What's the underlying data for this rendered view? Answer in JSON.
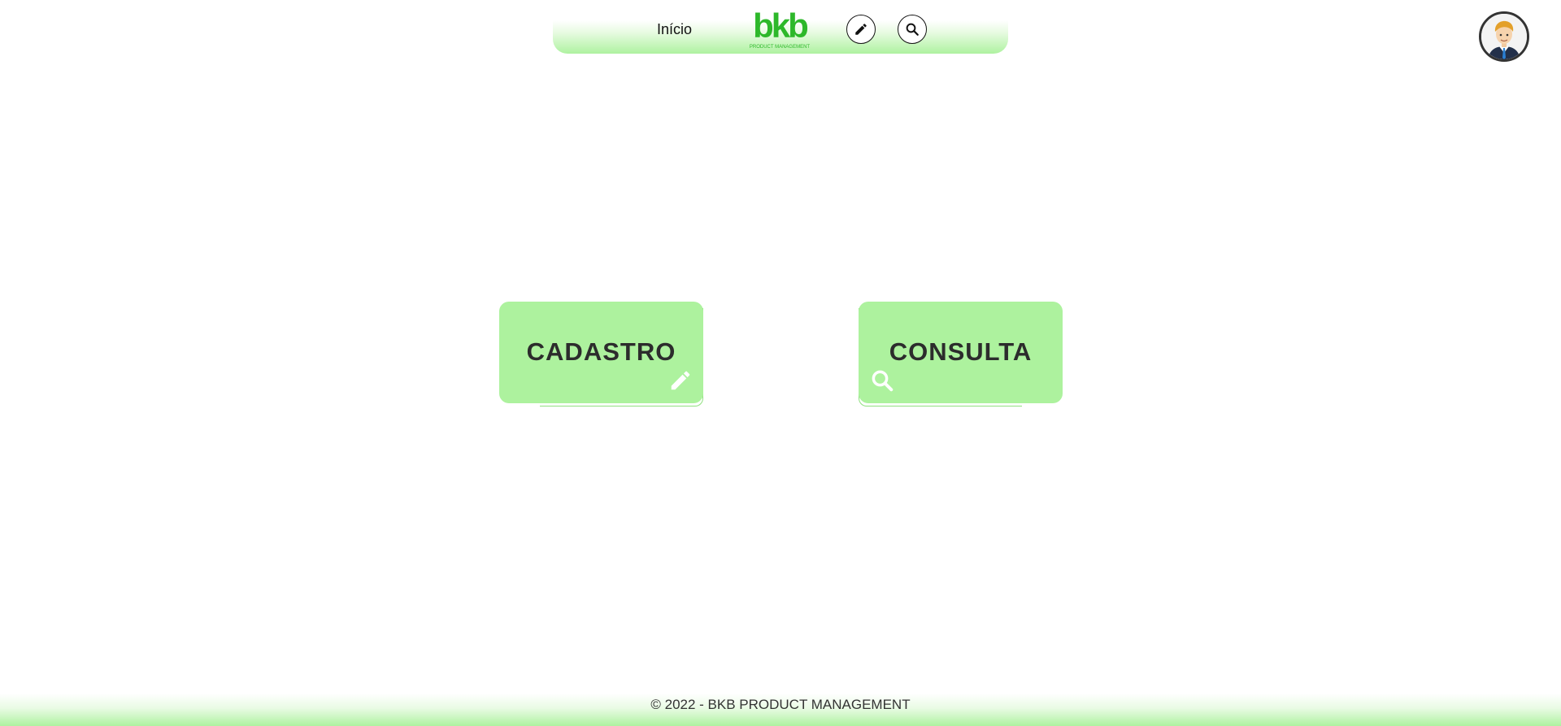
{
  "nav": {
    "home_label": "Início",
    "logo_text": "bkb",
    "logo_tagline": "PRODUCT MANAGEMENT",
    "icons": [
      "pencil-icon",
      "search-icon"
    ]
  },
  "user": {
    "avatar_icon": "user-avatar"
  },
  "cards": {
    "cadastro": {
      "label": "CADASTRO",
      "icon": "pencil-icon"
    },
    "consulta": {
      "label": "CONSULTA",
      "icon": "search-icon"
    }
  },
  "footer": {
    "text": "© 2022 - BKB PRODUCT MANAGEMENT"
  },
  "colors": {
    "brand_green": "#2db82a",
    "card_green": "#adf29e",
    "text_dark": "#2c2c2c"
  }
}
